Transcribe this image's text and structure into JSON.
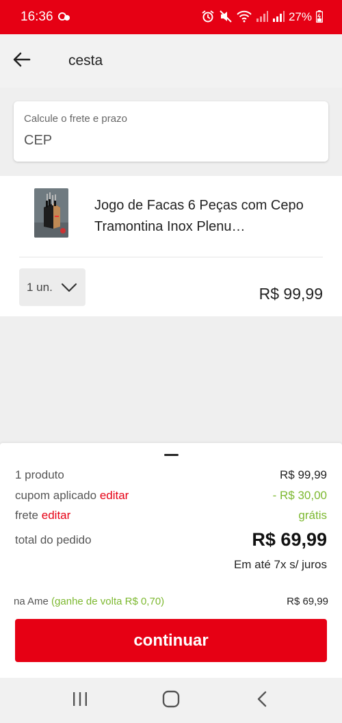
{
  "status_bar": {
    "time": "16:36",
    "battery": "27%"
  },
  "header": {
    "title": "cesta"
  },
  "shipping": {
    "label": "Calcule o frete e prazo",
    "placeholder": "CEP"
  },
  "product": {
    "name": "Jogo de Facas 6 Peças com Cepo Tramontina Inox Plenu…",
    "quantity": "1 un.",
    "price": "R$ 99,99"
  },
  "summary": {
    "products_label": "1 produto",
    "products_value": "R$ 99,99",
    "coupon_label": "cupom aplicado",
    "coupon_edit": "editar",
    "coupon_value": "- R$ 30,00",
    "shipping_label": "frete",
    "shipping_edit": "editar",
    "shipping_value": "grátis",
    "total_label": "total do pedido",
    "total_value": "R$ 69,99",
    "installments": "Em até 7x s/ juros",
    "ame_label": "na Ame",
    "ame_cashback": "(ganhe de volta R$ 0,70)",
    "ame_value": "R$ 69,99",
    "continue_label": "continuar"
  },
  "icons": {
    "back": "arrow-left-icon",
    "chevron": "chevron-down-icon",
    "nav_recent": "recent-apps-icon",
    "nav_home": "home-icon",
    "nav_back": "back-icon"
  },
  "colors": {
    "brand_red": "#e60014",
    "discount_green": "#7cb82f"
  }
}
